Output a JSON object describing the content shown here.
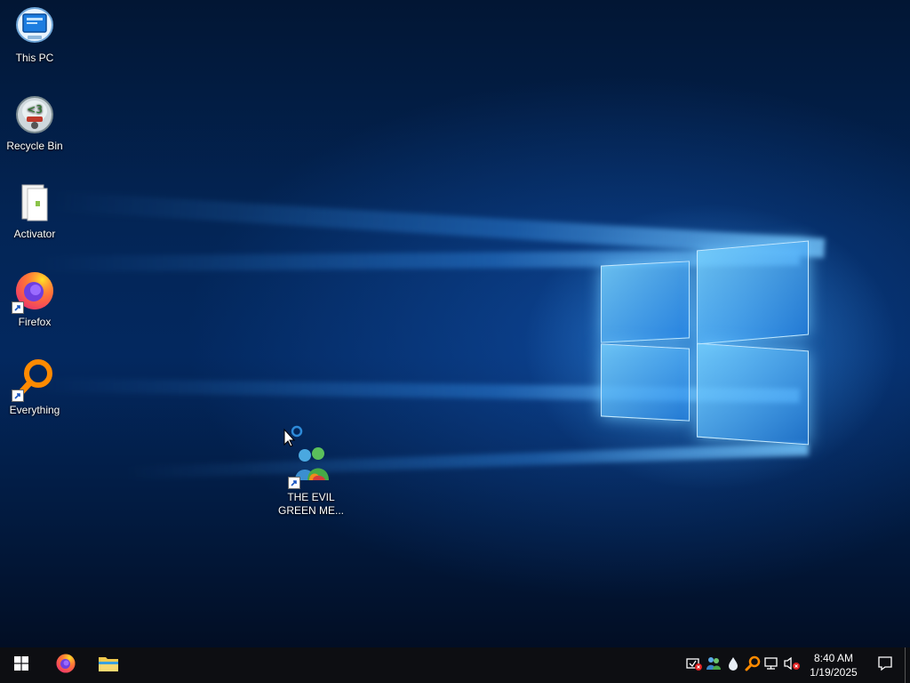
{
  "desktop": {
    "icons": [
      {
        "label": "This PC",
        "icon": "this-pc-icon"
      },
      {
        "label": "Recycle Bin",
        "icon": "recycle-bin-icon"
      },
      {
        "label": "Activator",
        "icon": "activator-icon"
      },
      {
        "label": "Firefox",
        "icon": "firefox-icon"
      },
      {
        "label": "Everything",
        "icon": "everything-icon"
      },
      {
        "label": "THE EVIL GREEN ME...",
        "line1": "THE EVIL",
        "line2": "GREEN ME...",
        "icon": "messenger-icon"
      }
    ]
  },
  "taskbar": {
    "start_icon": "windows-start-icon",
    "pinned": [
      {
        "name": "Firefox",
        "icon": "firefox-icon"
      },
      {
        "name": "File Explorer",
        "icon": "folder-icon"
      }
    ],
    "tray": [
      {
        "icon": "security-alert-icon"
      },
      {
        "icon": "users-icon"
      },
      {
        "icon": "droplet-icon"
      },
      {
        "icon": "everything-search-icon"
      },
      {
        "icon": "network-icon"
      },
      {
        "icon": "volume-muted-icon"
      }
    ],
    "clock": {
      "time": "8:40 AM",
      "date": "1/19/2025"
    },
    "notification_icon": "action-center-icon"
  },
  "colors": {
    "taskbar": "#0d0e12",
    "wallpaper_dark": "#021634",
    "wallpaper_glow": "#46aaff"
  }
}
